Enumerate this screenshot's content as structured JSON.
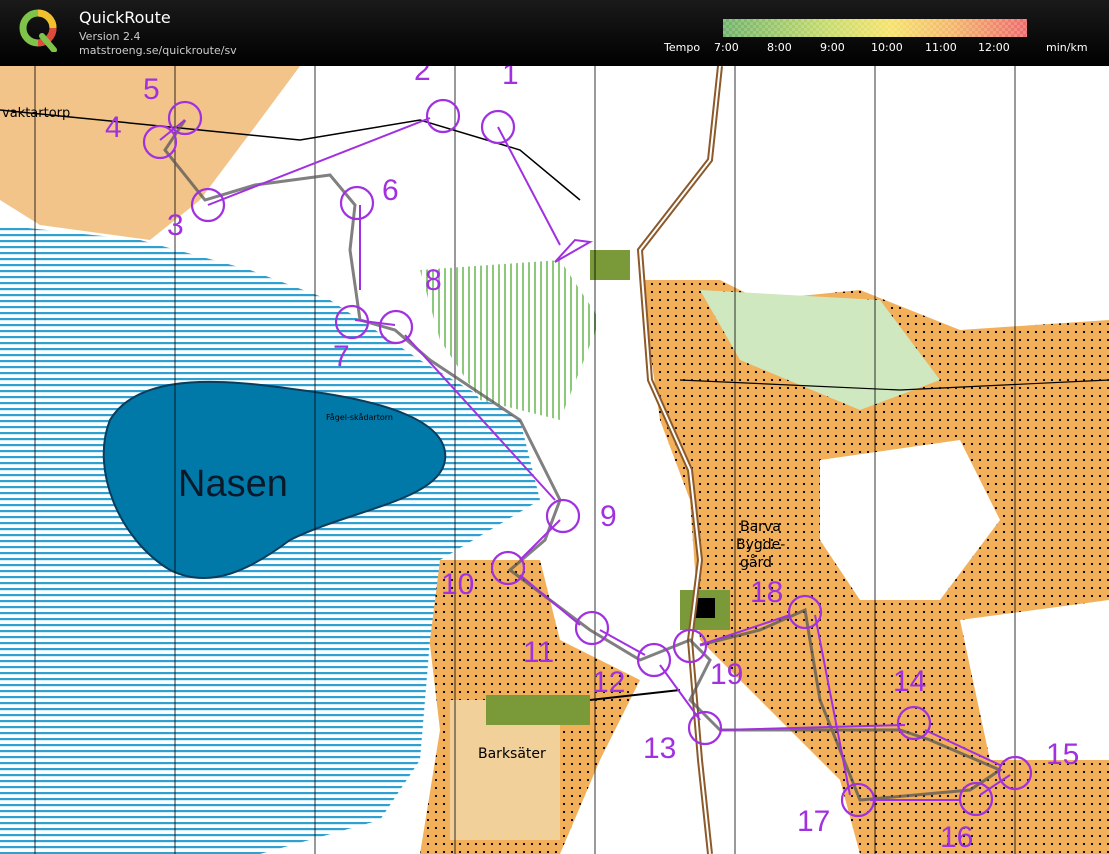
{
  "app": {
    "title": "QuickRoute",
    "version": "Version 2.4",
    "url": "matstroeng.se/quickroute/sv"
  },
  "tempo": {
    "label": "Tempo",
    "unit": "min/km",
    "ticks": [
      "7:00",
      "8:00",
      "9:00",
      "10:00",
      "11:00",
      "12:00"
    ]
  },
  "map": {
    "labels": {
      "lake": "Nasen",
      "place1": "vaktartorp",
      "place2": "Barksäter",
      "place3_line1": "Barva",
      "place3_line2": "Bygde-",
      "place3_line3": "gård",
      "tower": "Fågel-skådartorn"
    },
    "controls": [
      "1",
      "2",
      "3",
      "4",
      "5",
      "6",
      "7",
      "8",
      "9",
      "10",
      "11",
      "12",
      "13",
      "14",
      "15",
      "16",
      "17",
      "18",
      "19"
    ],
    "colors": {
      "course": "#a030e0",
      "water": "#0079a8",
      "marsh": "#2fa0d0",
      "open": "#f2b05a",
      "forest": "#ffffff",
      "green": "#8cc97a"
    }
  }
}
